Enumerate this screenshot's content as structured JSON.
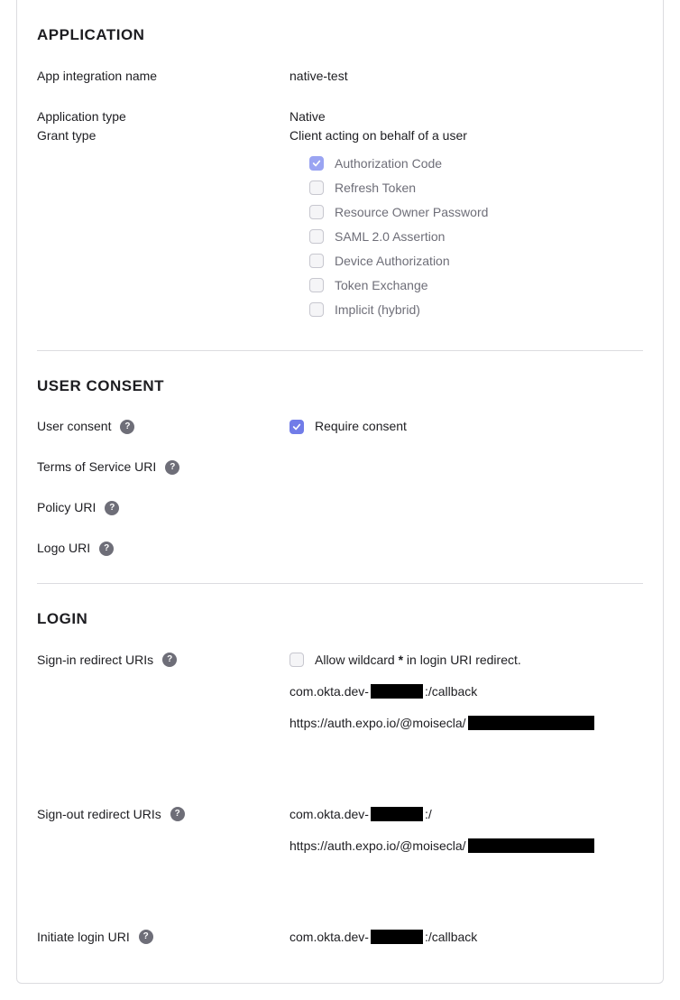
{
  "application": {
    "title": "APPLICATION",
    "integration_name_label": "App integration name",
    "integration_name_value": "native-test",
    "application_type_label": "Application type",
    "application_type_value": "Native",
    "grant_type_label": "Grant type",
    "grant_type_desc": "Client acting on behalf of a user",
    "grant_types": [
      {
        "label": "Authorization Code",
        "checked": true
      },
      {
        "label": "Refresh Token",
        "checked": false
      },
      {
        "label": "Resource Owner Password",
        "checked": false
      },
      {
        "label": "SAML 2.0 Assertion",
        "checked": false
      },
      {
        "label": "Device Authorization",
        "checked": false
      },
      {
        "label": "Token Exchange",
        "checked": false
      },
      {
        "label": "Implicit (hybrid)",
        "checked": false
      }
    ]
  },
  "user_consent": {
    "title": "USER CONSENT",
    "user_consent_label": "User consent",
    "require_consent_label": "Require consent",
    "require_consent_checked": true,
    "tos_label": "Terms of Service URI",
    "policy_label": "Policy URI",
    "logo_label": "Logo URI"
  },
  "login": {
    "title": "LOGIN",
    "signin_label": "Sign-in redirect URIs",
    "allow_wildcard_label_pre": "Allow wildcard ",
    "allow_wildcard_star": "*",
    "allow_wildcard_label_post": " in login URI redirect.",
    "allow_wildcard_checked": false,
    "signin_uri1_pre": "com.okta.dev-",
    "signin_uri1_post": ":/callback",
    "signin_uri2_pre": "https://auth.expo.io/@moisecla/",
    "signout_label": "Sign-out redirect URIs",
    "signout_uri1_pre": "com.okta.dev-",
    "signout_uri1_post": ":/",
    "signout_uri2_pre": "https://auth.expo.io/@moisecla/",
    "initiate_label": "Initiate login URI",
    "initiate_uri_pre": "com.okta.dev-",
    "initiate_uri_post": ":/callback"
  }
}
